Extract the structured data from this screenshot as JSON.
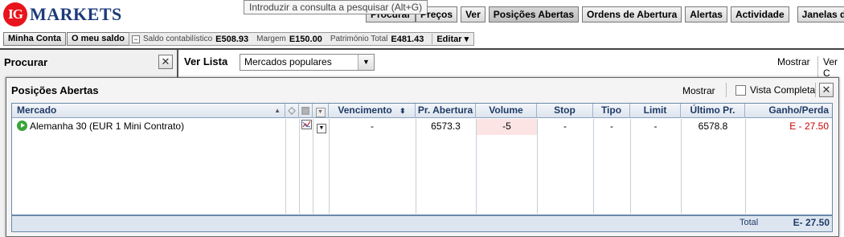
{
  "logo": {
    "mark": "IG",
    "text": "MARKETS"
  },
  "tooltip": "Introduzir a consulta a pesquisar (Alt+G)",
  "topnav": {
    "procurar": "Procurar",
    "precos": "Preços",
    "ver": "Ver",
    "posicoes": "Posições Abertas",
    "ordens": "Ordens de Abertura",
    "alertas": "Alertas",
    "actividade": "Actividade",
    "janelas": "Janelas de Operação"
  },
  "account": {
    "minha_conta": "Minha Conta",
    "meu_saldo": "O meu saldo",
    "collapse": "−",
    "saldo_label": "Saldo contabilístico",
    "saldo_value": "E508.93",
    "margem_label": "Margem",
    "margem_value": "E150.00",
    "patrimonio_label": "Património Total",
    "patrimonio_value": "E481.43",
    "editar": "Editar ▾"
  },
  "search_panel": {
    "title": "Procurar",
    "close": "✕"
  },
  "watchlist": {
    "label": "Ver Lista",
    "selected": "Mercados populares",
    "mostrar": "Mostrar",
    "ver_truncated": "Ver C"
  },
  "positions": {
    "title": "Posições Abertas",
    "mostrar": "Mostrar",
    "vista_completa": "Vista Completa",
    "vista_completa_checked": false,
    "close": "✕",
    "columns": {
      "mercado": "Mercado",
      "vencimento": "Vencimento",
      "pr_abertura": "Pr. Abertura",
      "volume": "Volume",
      "stop": "Stop",
      "tipo": "Tipo",
      "limit": "Limit",
      "ultimo_pr": "Último Pr.",
      "ganho_perda": "Ganho/Perda"
    },
    "rows": [
      {
        "mercado": "Alemanha 30 (EUR 1 Mini Contrato)",
        "vencimento": "-",
        "pr_abertura": "6573.3",
        "volume": "-5",
        "stop": "-",
        "tipo": "-",
        "limit": "-",
        "ultimo_pr": "6578.8",
        "ganho_perda": "E - 27.50"
      }
    ],
    "total_label": "Total",
    "total_value": "E- 27.50"
  },
  "colors": {
    "loss": "#cc0000",
    "header_text": "#1f3a66",
    "logo_red": "#e8141c",
    "logo_blue": "#1d3a7a",
    "volume_bg": "#fde4e4"
  }
}
